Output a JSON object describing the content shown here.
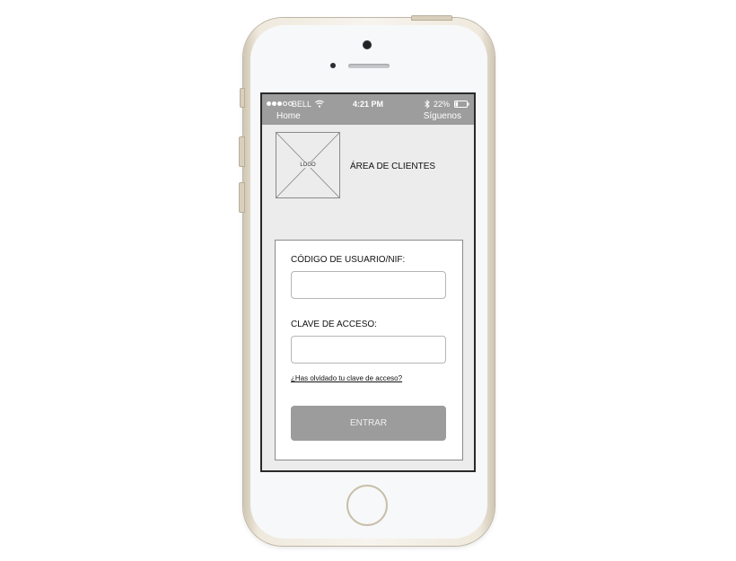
{
  "status_bar": {
    "carrier": "BELL",
    "time": "4:21 PM",
    "battery_percent": "22%",
    "signal_bars_filled": 3,
    "signal_bars_total": 5
  },
  "nav": {
    "home_label": "Home",
    "follow_label": "Síguenos"
  },
  "header": {
    "logo_text": "LOGO",
    "title": "ÁREA DE CLIENTES"
  },
  "login": {
    "user_label": "CÓDIGO DE USUARIO/NIF:",
    "user_value": "",
    "password_label": "CLAVE DE ACCESO:",
    "password_value": "",
    "forgot_link": "¿Has olvidado tu clave de acceso?",
    "submit_label": "ENTRAR"
  },
  "icons": {
    "wifi": "wifi-icon",
    "bluetooth": "bluetooth-icon",
    "battery": "battery-icon",
    "signal": "signal-icon",
    "logo_placeholder": "image-placeholder-icon"
  },
  "colors": {
    "status_bar_bg": "#9d9d9d",
    "screen_bg": "#ececec",
    "button_bg": "#9c9c9c",
    "phone_frame": "#efe9dd"
  }
}
